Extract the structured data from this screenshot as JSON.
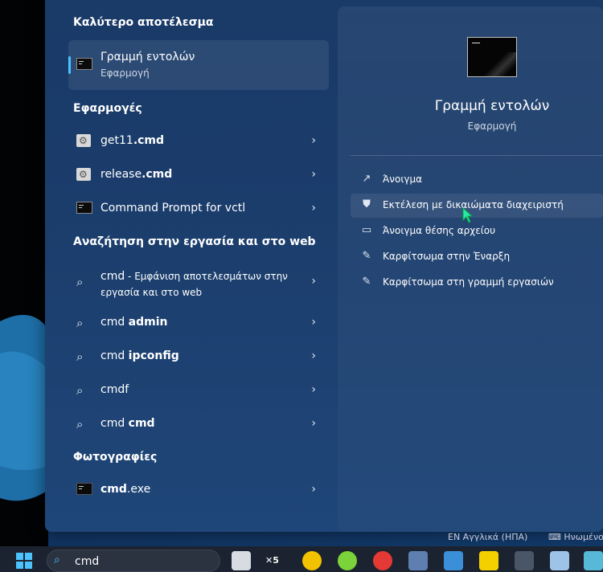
{
  "best_match": {
    "heading": "Καλύτερο αποτέλεσμα",
    "title": "Γραμμή εντολών",
    "subtitle": "Εφαρμογή"
  },
  "apps": {
    "heading": "Εφαρμογές",
    "items": [
      {
        "prefix": "get11",
        "bold": ".cmd",
        "icon": "batch-file-icon"
      },
      {
        "prefix": "release",
        "bold": ".cmd",
        "icon": "batch-file-icon"
      },
      {
        "prefix": "Command Prompt for vctl",
        "bold": "",
        "icon": "command-prompt-icon"
      }
    ]
  },
  "web": {
    "heading": "Αναζήτηση στην εργασία και στο web",
    "first": {
      "query": "cmd",
      "suffix": " - Εμφάνιση αποτελεσμάτων στην εργασία και στο web"
    },
    "items": [
      {
        "prefix": "cmd ",
        "bold": "admin"
      },
      {
        "prefix": "cmd ",
        "bold": "ipconfig"
      },
      {
        "prefix": "cmdf",
        "bold": ""
      },
      {
        "prefix": "cmd ",
        "bold": "cmd"
      }
    ]
  },
  "photos": {
    "heading": "Φωτογραφίες",
    "items": [
      {
        "prefix": "",
        "bold": "cmd",
        "suffix": ".exe"
      }
    ]
  },
  "detail": {
    "title": "Γραμμή εντολών",
    "subtitle": "Εφαρμογή",
    "actions": [
      {
        "label": "Άνοιγμα",
        "icon": "open-icon"
      },
      {
        "label": "Εκτέλεση με δικαιώματα διαχειριστή",
        "icon": "shield-icon"
      },
      {
        "label": "Άνοιγμα θέσης αρχείου",
        "icon": "folder-icon"
      },
      {
        "label": "Καρφίτσωμα στην Έναρξη",
        "icon": "pin-icon"
      },
      {
        "label": "Καρφίτσωμα στη γραμμή εργασιών",
        "icon": "pin-icon"
      }
    ]
  },
  "tray": {
    "language": "EN Αγγλικά (ΗΠΑ)",
    "keyboard": "Ηνωμένο"
  },
  "taskbar": {
    "search_value": "cmd"
  },
  "colors": {
    "accent": "#4cc2ff",
    "panel": "#1b3d6c"
  }
}
